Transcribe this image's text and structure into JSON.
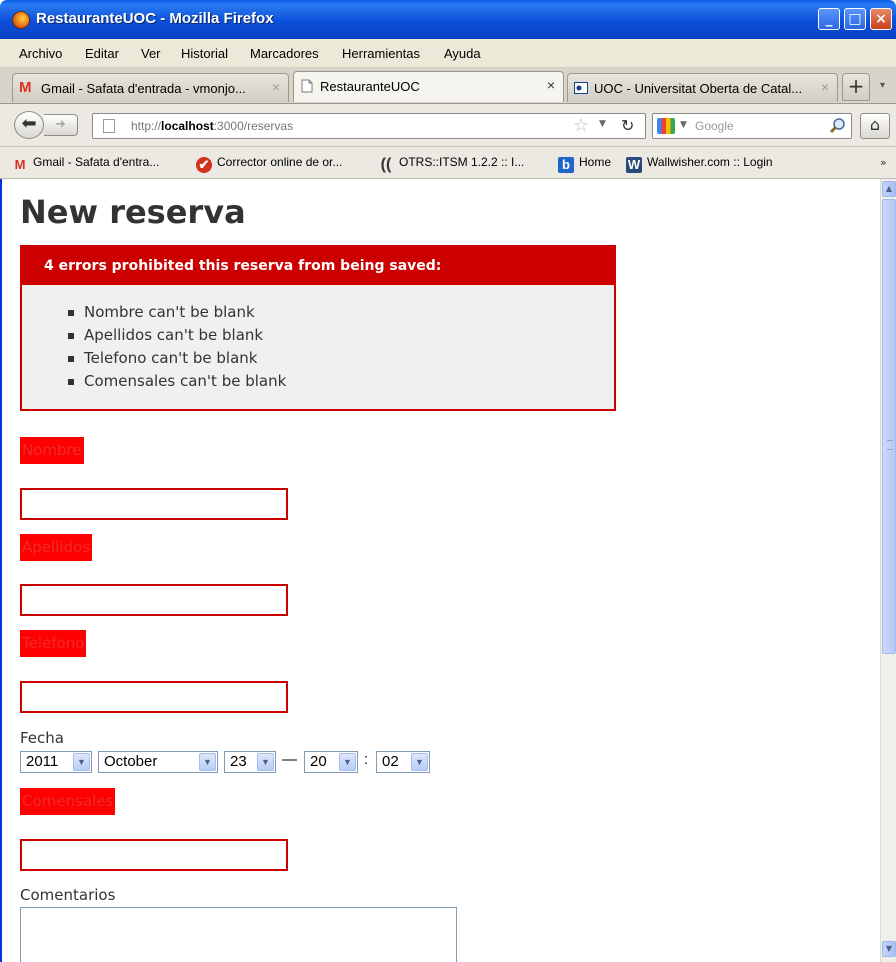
{
  "window": {
    "title": "RestauranteUOC - Mozilla Firefox",
    "controls": {
      "minimize": "_",
      "maximize": "□",
      "close": "×"
    }
  },
  "menu": [
    "Archivo",
    "Editar",
    "Ver",
    "Historial",
    "Marcadores",
    "Herramientas",
    "Ayuda"
  ],
  "tabs": [
    {
      "label": "Gmail - Safata d'entrada - vmonjo...",
      "icon": "gmail-icon",
      "active": false
    },
    {
      "label": "RestauranteUOC",
      "icon": "page-icon",
      "active": true
    },
    {
      "label": "UOC - Universitat Oberta de Catal...",
      "icon": "uoc-icon",
      "active": false
    }
  ],
  "tab_close": "×",
  "new_tab": "+",
  "nav": {
    "url_prefix": "http://",
    "url_host": "localhost",
    "url_rest": ":3000/reservas",
    "search_placeholder": "Google"
  },
  "bookmarks": [
    {
      "label": "Gmail - Safata d'entra...",
      "icon": "gmail-icon"
    },
    {
      "label": "Corrector online de or...",
      "icon": "corrector-icon"
    },
    {
      "label": "OTRS::ITSM 1.2.2 :: I...",
      "icon": "otrs-icon"
    },
    {
      "label": "Home",
      "icon": "b-icon"
    },
    {
      "label": "Wallwisher.com :: Login",
      "icon": "w-icon"
    }
  ],
  "page": {
    "title": "New reserva",
    "error_header": "4 errors prohibited this reserva from being saved:",
    "errors": [
      "Nombre can't be blank",
      "Apellidos can't be blank",
      "Telefono can't be blank",
      "Comensales can't be blank"
    ],
    "fields": {
      "nombre": "Nombre",
      "apellidos": "Apellidos",
      "telefono": "Telefono",
      "fecha": "Fecha",
      "comensales": "Comensales",
      "comentarios": "Comentarios"
    },
    "date": {
      "year": "2011",
      "month": "October",
      "day": "23",
      "dash": "—",
      "hour": "20",
      "colon": ":",
      "minute": "02"
    }
  },
  "colors": {
    "error_red": "#cc0000",
    "title_bar": "#0b4fd9",
    "label_bg": "#ff0000"
  }
}
